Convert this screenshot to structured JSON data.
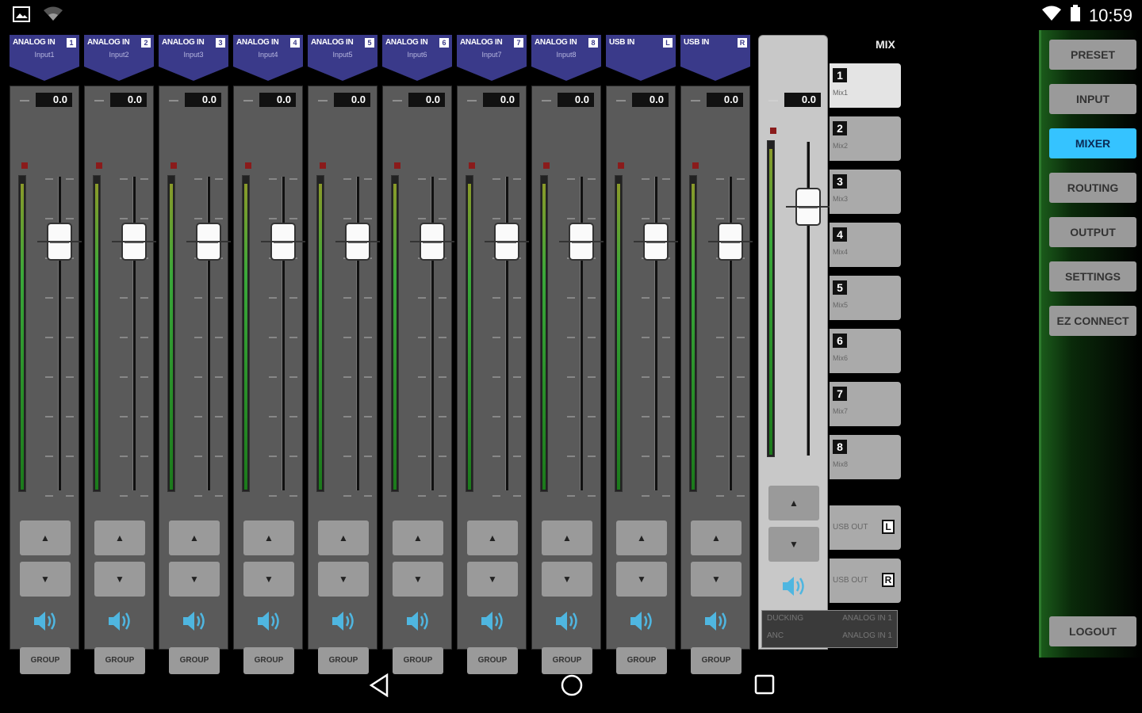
{
  "status": {
    "time": "10:59"
  },
  "colors": {
    "accent": "#35c3ff",
    "tag": "#3a3a8a",
    "strip": "#5a5a5a",
    "meter": "#2f9a2f"
  },
  "channels": [
    {
      "name": "ANALOG IN",
      "num": "1",
      "sub": "Input1",
      "value": "0.0",
      "level": 0.98,
      "group": "GROUP"
    },
    {
      "name": "ANALOG IN",
      "num": "2",
      "sub": "Input2",
      "value": "0.0",
      "level": 0.98,
      "group": "GROUP"
    },
    {
      "name": "ANALOG IN",
      "num": "3",
      "sub": "Input3",
      "value": "0.0",
      "level": 0.98,
      "group": "GROUP"
    },
    {
      "name": "ANALOG IN",
      "num": "4",
      "sub": "Input4",
      "value": "0.0",
      "level": 0.98,
      "group": "GROUP"
    },
    {
      "name": "ANALOG IN",
      "num": "5",
      "sub": "Input5",
      "value": "0.0",
      "level": 0.98,
      "group": "GROUP"
    },
    {
      "name": "ANALOG IN",
      "num": "6",
      "sub": "Input6",
      "value": "0.0",
      "level": 0.98,
      "group": "GROUP"
    },
    {
      "name": "ANALOG IN",
      "num": "7",
      "sub": "Input7",
      "value": "0.0",
      "level": 0.98,
      "group": "GROUP"
    },
    {
      "name": "ANALOG IN",
      "num": "8",
      "sub": "Input8",
      "value": "0.0",
      "level": 0.98,
      "group": "GROUP"
    },
    {
      "name": "USB IN",
      "num": "L",
      "sub": "",
      "value": "0.0",
      "level": 0.98,
      "group": "GROUP"
    },
    {
      "name": "USB IN",
      "num": "R",
      "sub": "",
      "value": "0.0",
      "level": 0.98,
      "group": "GROUP"
    }
  ],
  "master": {
    "value": "0.0",
    "level": 0.98,
    "ducking_label": "DUCKING",
    "ducking_value": "ANALOG IN 1",
    "anc_label": "ANC",
    "anc_value": "ANALOG IN 1"
  },
  "mix": {
    "title": "MIX",
    "items": [
      {
        "num": "1",
        "label": "Mix1"
      },
      {
        "num": "2",
        "label": "Mix2"
      },
      {
        "num": "3",
        "label": "Mix3"
      },
      {
        "num": "4",
        "label": "Mix4"
      },
      {
        "num": "5",
        "label": "Mix5"
      },
      {
        "num": "6",
        "label": "Mix6"
      },
      {
        "num": "7",
        "label": "Mix7"
      },
      {
        "num": "8",
        "label": "Mix8"
      }
    ],
    "usb": [
      {
        "label": "USB OUT",
        "ch": "L"
      },
      {
        "label": "USB OUT",
        "ch": "R"
      }
    ]
  },
  "nav": {
    "items": [
      "PRESET",
      "INPUT",
      "MIXER",
      "ROUTING",
      "OUTPUT",
      "SETTINGS",
      "EZ CONNECT"
    ],
    "active": "MIXER",
    "logout": "LOGOUT"
  },
  "icons": [
    "image-icon",
    "wifi-icon",
    "signal-icon",
    "battery-icon",
    "speaker-icon",
    "back-icon",
    "home-icon",
    "recents-icon"
  ]
}
